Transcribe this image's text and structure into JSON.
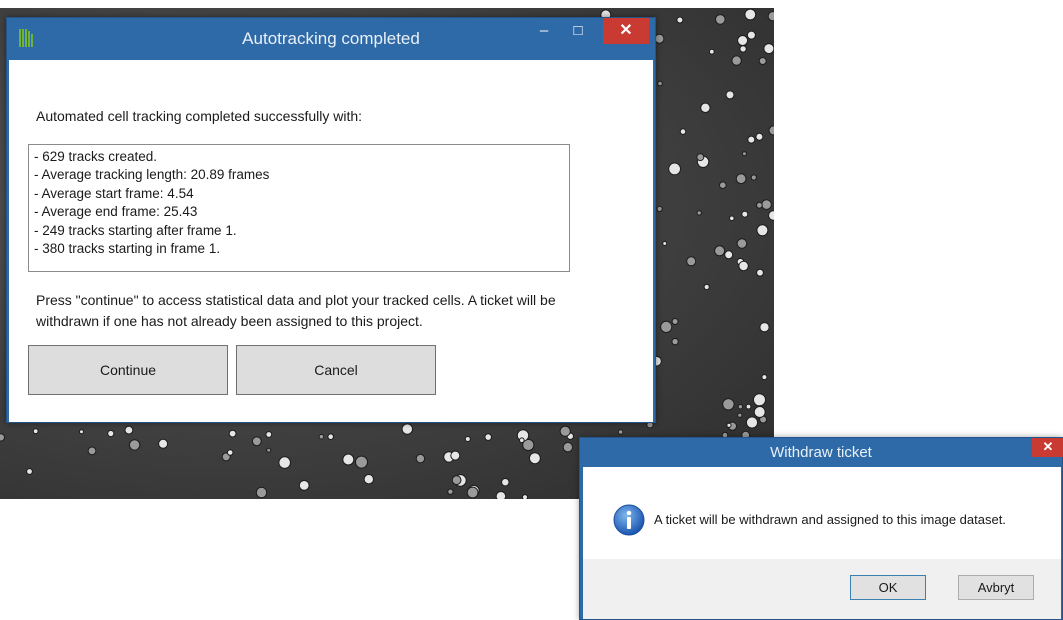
{
  "main_dialog": {
    "title": "Autotracking completed",
    "minimize_glyph": "–",
    "maximize_glyph": "□",
    "close_glyph": "✕",
    "intro": "Automated cell tracking completed successfully with:",
    "results": [
      "- 629 tracks created.",
      "- Average tracking length: 20.89 frames",
      "- Average start frame: 4.54",
      "- Average end frame: 25.43",
      "- 249 tracks starting after frame 1.",
      "- 380 tracks starting in frame 1."
    ],
    "info": "Press \"continue\" to access statistical data and plot your tracked cells. A ticket will be withdrawn if one has not already been assigned to this project.",
    "continue_label": "Continue",
    "cancel_label": "Cancel"
  },
  "withdraw_dialog": {
    "title": "Withdraw ticket",
    "close_glyph": "✕",
    "message": "A ticket will be withdrawn and assigned to this image dataset.",
    "ok_label": "OK",
    "avbryt_label": "Avbryt",
    "icon": "info-icon"
  },
  "colors": {
    "titlebar": "#2f6aa8",
    "close": "#c93a33",
    "button_face": "#dddddd",
    "footer": "#f0f0f0"
  }
}
